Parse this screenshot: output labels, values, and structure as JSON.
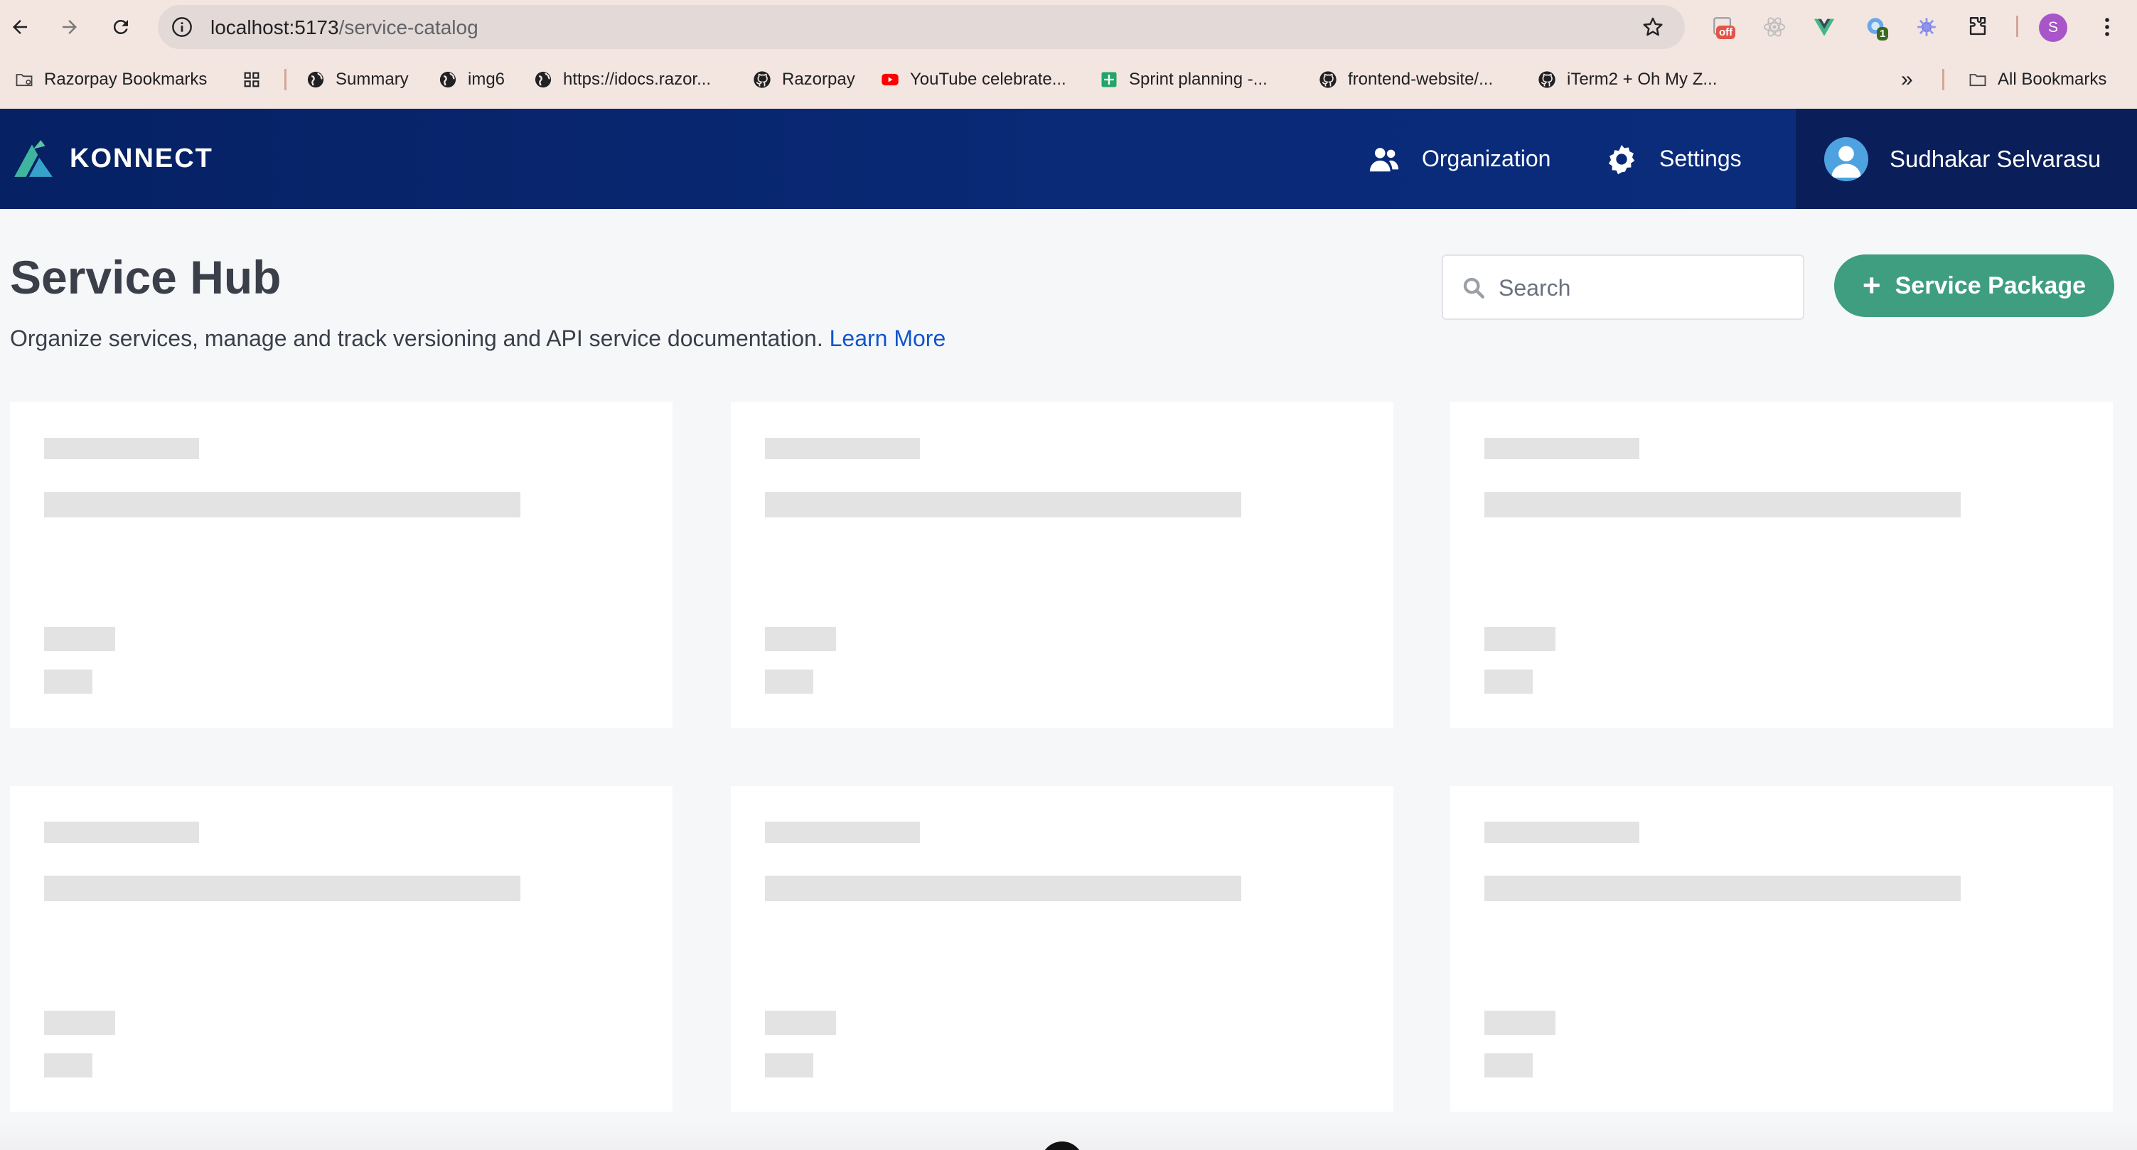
{
  "browser": {
    "url_host": "localhost:5173",
    "url_path": "/service-catalog",
    "extensions": {
      "off_badge": "off",
      "count_badge": "1"
    },
    "profile_initial": "S",
    "bookmarks": [
      {
        "label": "Razorpay Bookmarks",
        "icon": "folder-icon"
      },
      {
        "label": "Summary",
        "icon": "globe-icon"
      },
      {
        "label": "img6",
        "icon": "globe-icon"
      },
      {
        "label": "https://idocs.razor...",
        "icon": "globe-icon"
      },
      {
        "label": "Razorpay",
        "icon": "github-icon"
      },
      {
        "label": "YouTube celebrate...",
        "icon": "youtube-icon"
      },
      {
        "label": "Sprint planning -...",
        "icon": "sheets-icon"
      },
      {
        "label": "frontend-website/...",
        "icon": "github-icon"
      },
      {
        "label": "iTerm2 + Oh My Z...",
        "icon": "github-icon"
      }
    ],
    "overflow_label": "»",
    "all_bookmarks": "All Bookmarks"
  },
  "app": {
    "brand": "KONNECT",
    "nav": {
      "organization": "Organization",
      "settings": "Settings"
    },
    "user_name": "Sudhakar Selvarasu"
  },
  "page": {
    "title": "Service Hub",
    "description": "Organize services, manage and track versioning and API service documentation.",
    "learn_more": "Learn More",
    "search_placeholder": "Search",
    "create_button": "Service Package",
    "cards_loading": 6
  },
  "colors": {
    "header": "#062164",
    "accent": "#3e9e7f",
    "link": "#1155cc",
    "skeleton": "#e3e3e3"
  }
}
